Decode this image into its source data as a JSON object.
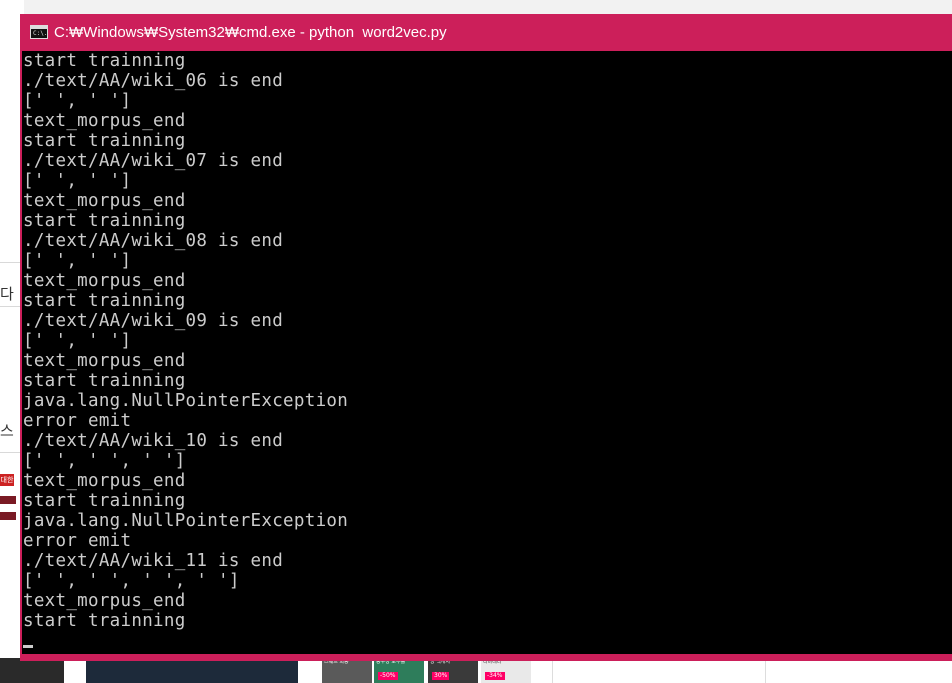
{
  "window": {
    "title": "C:₩Windows₩System32₩cmd.exe - python  word2vec.py",
    "icon": "cmd-console-icon",
    "icon_text": "C:\\.",
    "accent_color": "#cc1f5a"
  },
  "terminal": {
    "background": "#000000",
    "foreground": "#cccccc",
    "lines": [
      "start trainning",
      "./text/AA/wiki_06 is end",
      "[' ', ' ']",
      "text_morpus_end",
      "start trainning",
      "./text/AA/wiki_07 is end",
      "[' ', ' ']",
      "text_morpus_end",
      "start trainning",
      "./text/AA/wiki_08 is end",
      "[' ', ' ']",
      "text_morpus_end",
      "start trainning",
      "./text/AA/wiki_09 is end",
      "[' ', ' ']",
      "text_morpus_end",
      "start trainning",
      "java.lang.NullPointerException",
      "error emit",
      "./text/AA/wiki_10 is end",
      "[' ', ' ', ' ']",
      "text_morpus_end",
      "start trainning",
      "java.lang.NullPointerException",
      "error emit",
      "./text/AA/wiki_11 is end",
      "[' ', ' ', ' ', ' ']",
      "text_morpus_end",
      "start trainning"
    ]
  },
  "background": {
    "left_glyphs": [
      "다",
      "스"
    ],
    "left_tag": "대한",
    "thumbs": [
      {
        "caption": "스웨드 회동",
        "badge": "",
        "color": "#5a5a5a"
      },
      {
        "caption": "농구장 토투를",
        "badge": "-50%",
        "color": "#2e7d5b"
      },
      {
        "caption": "망 백개시",
        "badge": "30%",
        "color": "#3a3a3a"
      },
      {
        "caption": "리바래터",
        "badge": "-34%",
        "color": "#e9e9e9"
      }
    ]
  }
}
